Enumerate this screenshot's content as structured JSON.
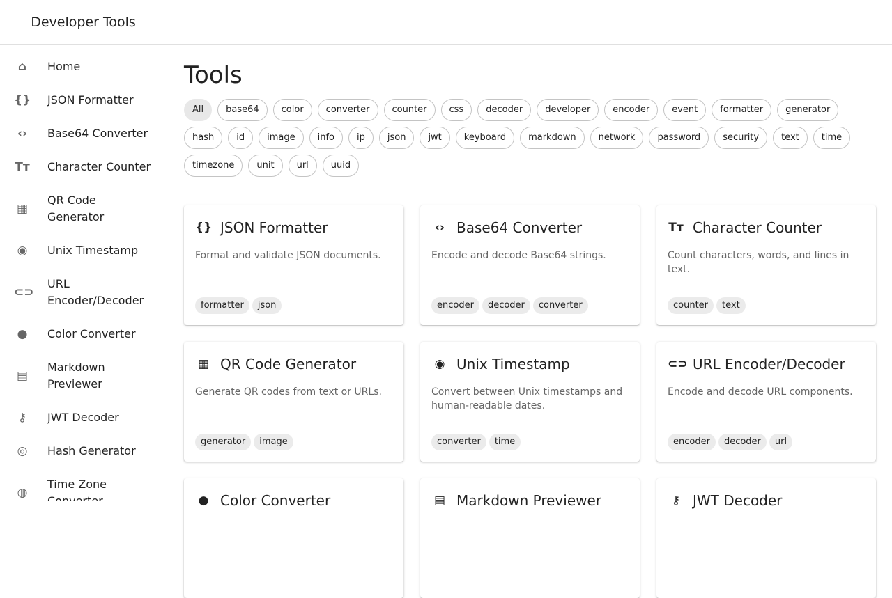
{
  "app_title": "Developer Tools",
  "page_title": "Tools",
  "nav": [
    {
      "label": "Home",
      "icon": "home-icon",
      "glyph": "⌂"
    },
    {
      "label": "JSON Formatter",
      "icon": "braces-icon",
      "glyph": "{}"
    },
    {
      "label": "Base64 Converter",
      "icon": "code-icon",
      "glyph": "‹›"
    },
    {
      "label": "Character Counter",
      "icon": "text-fields-icon",
      "glyph": "Tт"
    },
    {
      "label": "QR Code Generator",
      "icon": "qr-code-icon",
      "glyph": "▦"
    },
    {
      "label": "Unix Timestamp",
      "icon": "timer-icon",
      "glyph": "◉"
    },
    {
      "label": "URL Encoder/Decoder",
      "icon": "link-icon",
      "glyph": "⊂⊃"
    },
    {
      "label": "Color Converter",
      "icon": "palette-icon",
      "glyph": "●"
    },
    {
      "label": "Markdown Previewer",
      "icon": "article-icon",
      "glyph": "▤"
    },
    {
      "label": "JWT Decoder",
      "icon": "key-icon",
      "glyph": "⚷"
    },
    {
      "label": "Hash Generator",
      "icon": "fingerprint-icon",
      "glyph": "◎"
    },
    {
      "label": "Time Zone Converter",
      "icon": "globe-icon",
      "glyph": "◍"
    }
  ],
  "filters": [
    "All",
    "base64",
    "color",
    "converter",
    "counter",
    "css",
    "decoder",
    "developer",
    "encoder",
    "event",
    "formatter",
    "generator",
    "hash",
    "id",
    "image",
    "info",
    "ip",
    "json",
    "jwt",
    "keyboard",
    "markdown",
    "network",
    "password",
    "security",
    "text",
    "time",
    "timezone",
    "unit",
    "url",
    "uuid"
  ],
  "active_filter": "All",
  "cards": [
    {
      "title": "JSON Formatter",
      "icon": "braces-icon",
      "glyph": "{}",
      "desc": "Format and validate JSON documents.",
      "tags": [
        "formatter",
        "json"
      ]
    },
    {
      "title": "Base64 Converter",
      "icon": "code-icon",
      "glyph": "‹›",
      "desc": "Encode and decode Base64 strings.",
      "tags": [
        "encoder",
        "decoder",
        "converter"
      ]
    },
    {
      "title": "Character Counter",
      "icon": "text-fields-icon",
      "glyph": "Tт",
      "desc": "Count characters, words, and lines in text.",
      "tags": [
        "counter",
        "text"
      ]
    },
    {
      "title": "QR Code Generator",
      "icon": "qr-code-icon",
      "glyph": "▦",
      "desc": "Generate QR codes from text or URLs.",
      "tags": [
        "generator",
        "image"
      ]
    },
    {
      "title": "Unix Timestamp",
      "icon": "timer-icon",
      "glyph": "◉",
      "desc": "Convert between Unix timestamps and human-readable dates.",
      "tags": [
        "converter",
        "time"
      ]
    },
    {
      "title": "URL Encoder/Decoder",
      "icon": "link-icon",
      "glyph": "⊂⊃",
      "desc": "Encode and decode URL components.",
      "tags": [
        "encoder",
        "decoder",
        "url"
      ]
    },
    {
      "title": "Color Converter",
      "icon": "palette-icon",
      "glyph": "●",
      "desc": "",
      "tags": []
    },
    {
      "title": "Markdown Previewer",
      "icon": "article-icon",
      "glyph": "▤",
      "desc": "",
      "tags": []
    },
    {
      "title": "JWT Decoder",
      "icon": "key-icon",
      "glyph": "⚷",
      "desc": "",
      "tags": []
    }
  ]
}
